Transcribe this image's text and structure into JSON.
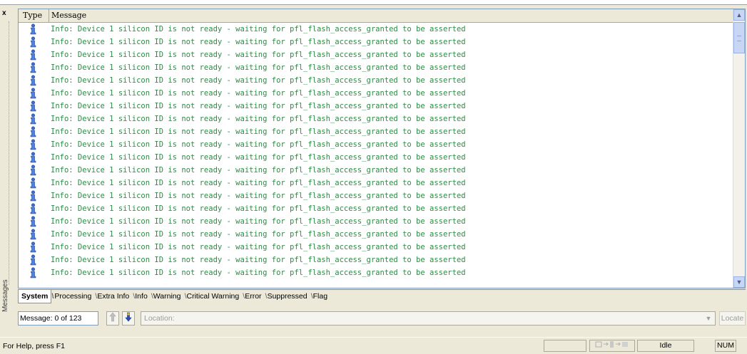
{
  "panel": {
    "title": "Messages",
    "close_glyph": "x"
  },
  "columns": {
    "type": "Type",
    "message": "Message"
  },
  "messages": [
    {
      "type": "info",
      "text": "Info: Device 1 silicon ID is not ready - waiting for pfl_flash_access_granted to be asserted"
    },
    {
      "type": "info",
      "text": "Info: Device 1 silicon ID is not ready - waiting for pfl_flash_access_granted to be asserted"
    },
    {
      "type": "info",
      "text": "Info: Device 1 silicon ID is not ready - waiting for pfl_flash_access_granted to be asserted"
    },
    {
      "type": "info",
      "text": "Info: Device 1 silicon ID is not ready - waiting for pfl_flash_access_granted to be asserted"
    },
    {
      "type": "info",
      "text": "Info: Device 1 silicon ID is not ready - waiting for pfl_flash_access_granted to be asserted"
    },
    {
      "type": "info",
      "text": "Info: Device 1 silicon ID is not ready - waiting for pfl_flash_access_granted to be asserted"
    },
    {
      "type": "info",
      "text": "Info: Device 1 silicon ID is not ready - waiting for pfl_flash_access_granted to be asserted"
    },
    {
      "type": "info",
      "text": "Info: Device 1 silicon ID is not ready - waiting for pfl_flash_access_granted to be asserted"
    },
    {
      "type": "info",
      "text": "Info: Device 1 silicon ID is not ready - waiting for pfl_flash_access_granted to be asserted"
    },
    {
      "type": "info",
      "text": "Info: Device 1 silicon ID is not ready - waiting for pfl_flash_access_granted to be asserted"
    },
    {
      "type": "info",
      "text": "Info: Device 1 silicon ID is not ready - waiting for pfl_flash_access_granted to be asserted"
    },
    {
      "type": "info",
      "text": "Info: Device 1 silicon ID is not ready - waiting for pfl_flash_access_granted to be asserted"
    },
    {
      "type": "info",
      "text": "Info: Device 1 silicon ID is not ready - waiting for pfl_flash_access_granted to be asserted"
    },
    {
      "type": "info",
      "text": "Info: Device 1 silicon ID is not ready - waiting for pfl_flash_access_granted to be asserted"
    },
    {
      "type": "info",
      "text": "Info: Device 1 silicon ID is not ready - waiting for pfl_flash_access_granted to be asserted"
    },
    {
      "type": "info",
      "text": "Info: Device 1 silicon ID is not ready - waiting for pfl_flash_access_granted to be asserted"
    },
    {
      "type": "info",
      "text": "Info: Device 1 silicon ID is not ready - waiting for pfl_flash_access_granted to be asserted"
    },
    {
      "type": "info",
      "text": "Info: Device 1 silicon ID is not ready - waiting for pfl_flash_access_granted to be asserted"
    },
    {
      "type": "info",
      "text": "Info: Device 1 silicon ID is not ready - waiting for pfl_flash_access_granted to be asserted"
    },
    {
      "type": "info",
      "text": "Info: Device 1 silicon ID is not ready - waiting for pfl_flash_access_granted to be asserted"
    }
  ],
  "tabs": [
    {
      "label": "System",
      "active": true
    },
    {
      "label": "Processing"
    },
    {
      "label": "Extra Info"
    },
    {
      "label": "Info"
    },
    {
      "label": "Warning"
    },
    {
      "label": "Critical Warning"
    },
    {
      "label": "Error"
    },
    {
      "label": "Suppressed"
    },
    {
      "label": "Flag"
    }
  ],
  "message_bar": {
    "count": "Message: 0 of 123",
    "location_placeholder": "Location:",
    "locate_label": "Locate"
  },
  "status_bar": {
    "help": "For Help, press F1",
    "state": "Idle",
    "num": "NUM"
  },
  "colors": {
    "message_text": "#2e8b45",
    "info_icon": "#3a6fd8",
    "window_bg": "#ece9d8"
  },
  "icons": {
    "row": "info-icon",
    "up": "up-arrow-icon",
    "down": "down-arrow-icon"
  }
}
